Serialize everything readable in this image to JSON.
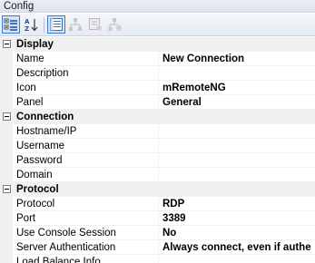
{
  "window": {
    "title": "Config"
  },
  "toolbar": {
    "buttons": [
      {
        "name": "categorized-view-button",
        "icon": "categorized-icon",
        "active": true
      },
      {
        "name": "alphabetical-view-button",
        "icon": "sort-az-icon",
        "active": false
      },
      {
        "name": "properties-view-button",
        "icon": "properties-icon",
        "active": true
      },
      {
        "name": "inheritance-button",
        "icon": "inheritance-tree-icon",
        "active": false
      },
      {
        "name": "default-properties-button",
        "icon": "default-properties-icon",
        "active": false
      },
      {
        "name": "default-inheritance-button",
        "icon": "default-inheritance-icon",
        "active": false
      }
    ]
  },
  "grid": {
    "categories": [
      {
        "label": "Display",
        "props": [
          {
            "name": "Name",
            "value": "New Connection"
          },
          {
            "name": "Description",
            "value": ""
          },
          {
            "name": "Icon",
            "value": "mRemoteNG"
          },
          {
            "name": "Panel",
            "value": "General"
          }
        ]
      },
      {
        "label": "Connection",
        "props": [
          {
            "name": "Hostname/IP",
            "value": ""
          },
          {
            "name": "Username",
            "value": ""
          },
          {
            "name": "Password",
            "value": ""
          },
          {
            "name": "Domain",
            "value": ""
          }
        ]
      },
      {
        "label": "Protocol",
        "props": [
          {
            "name": "Protocol",
            "value": "RDP"
          },
          {
            "name": "Port",
            "value": "3389"
          },
          {
            "name": "Use Console Session",
            "value": "No"
          },
          {
            "name": "Server Authentication",
            "value": "Always connect, even if authe"
          },
          {
            "name": "Load Balance Info",
            "value": ""
          }
        ]
      }
    ]
  },
  "colors": {
    "accent": "#3d7bd6",
    "category_bg": "#f0f0f0",
    "toolbar_bg": "#e6ebf3"
  }
}
